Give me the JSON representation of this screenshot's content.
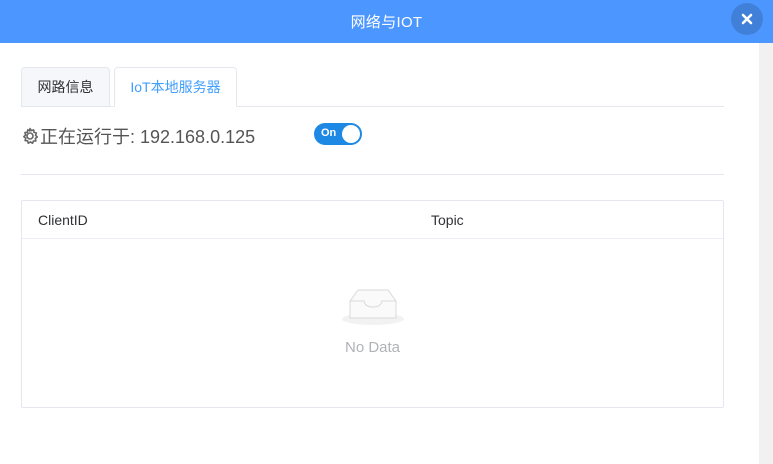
{
  "dialog": {
    "title": "网络与IOT",
    "close_icon": "close-icon"
  },
  "tabs": [
    {
      "label": "网路信息",
      "active": false
    },
    {
      "label": "IoT本地服务器",
      "active": true
    }
  ],
  "server": {
    "status_icon": "gear-icon",
    "status_text": "正在运行于: 192.168.0.125",
    "switch_label": "On",
    "switch_on": true
  },
  "table": {
    "columns": [
      "ClientID",
      "Topic"
    ],
    "empty_icon": "inbox-icon",
    "empty_text": "No Data"
  },
  "colors": {
    "header": "#4c97ff",
    "accent": "#409eff",
    "switch": "#1e88e5"
  }
}
